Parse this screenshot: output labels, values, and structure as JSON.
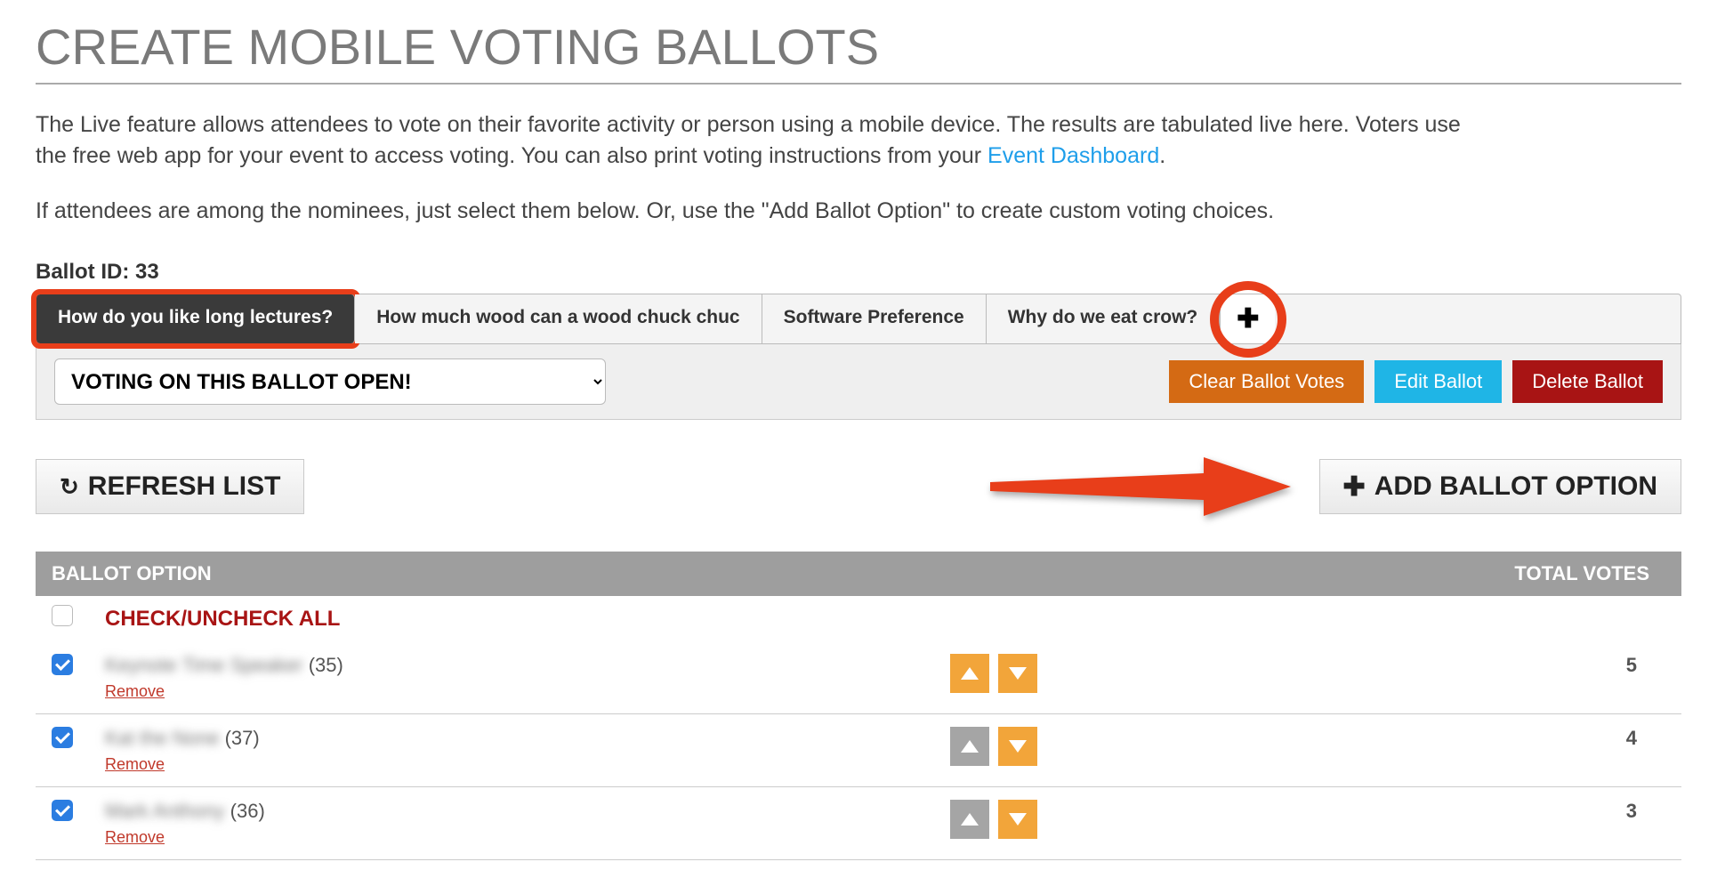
{
  "page": {
    "title": "CREATE MOBILE VOTING BALLOTS",
    "intro_prefix": "The Live feature allows attendees to vote on their favorite activity or person using a mobile device. The results are tabulated live here. Voters use the free web app for your event to access voting. You can also print voting instructions from your ",
    "intro_link": "Event Dashboard",
    "intro_suffix": ".",
    "sub_intro": "If attendees are among the nominees, just select them below. Or, use the \"Add Ballot Option\" to create custom voting choices.",
    "ballot_id_label": "Ballot ID:",
    "ballot_id_value": "33"
  },
  "tabs": {
    "items": [
      "How do you like long lectures?",
      "How much wood can a wood chuck chuc",
      "Software Preference",
      "Why do we eat crow?"
    ],
    "active_index": 0
  },
  "toolbar": {
    "voting_status_selected": "VOTING ON THIS BALLOT OPEN!",
    "clear_votes": "Clear Ballot Votes",
    "edit_ballot": "Edit Ballot",
    "delete_ballot": "Delete Ballot"
  },
  "actions": {
    "refresh": "REFRESH LIST",
    "add_option": "ADD BALLOT OPTION"
  },
  "table": {
    "col_option": "BALLOT OPTION",
    "col_votes": "TOTAL VOTES",
    "check_all": "CHECK/UNCHECK ALL",
    "remove_label": "Remove",
    "rows": [
      {
        "name_blur": "Keynote Time Speaker",
        "count": "(35)",
        "up_enabled": true,
        "down_enabled": true,
        "votes": "5",
        "checked": true
      },
      {
        "name_blur": "Kat the None",
        "count": "(37)",
        "up_enabled": false,
        "down_enabled": true,
        "votes": "4",
        "checked": true
      },
      {
        "name_blur": "Mark Anthony",
        "count": "(36)",
        "up_enabled": false,
        "down_enabled": true,
        "votes": "3",
        "checked": true
      }
    ]
  }
}
